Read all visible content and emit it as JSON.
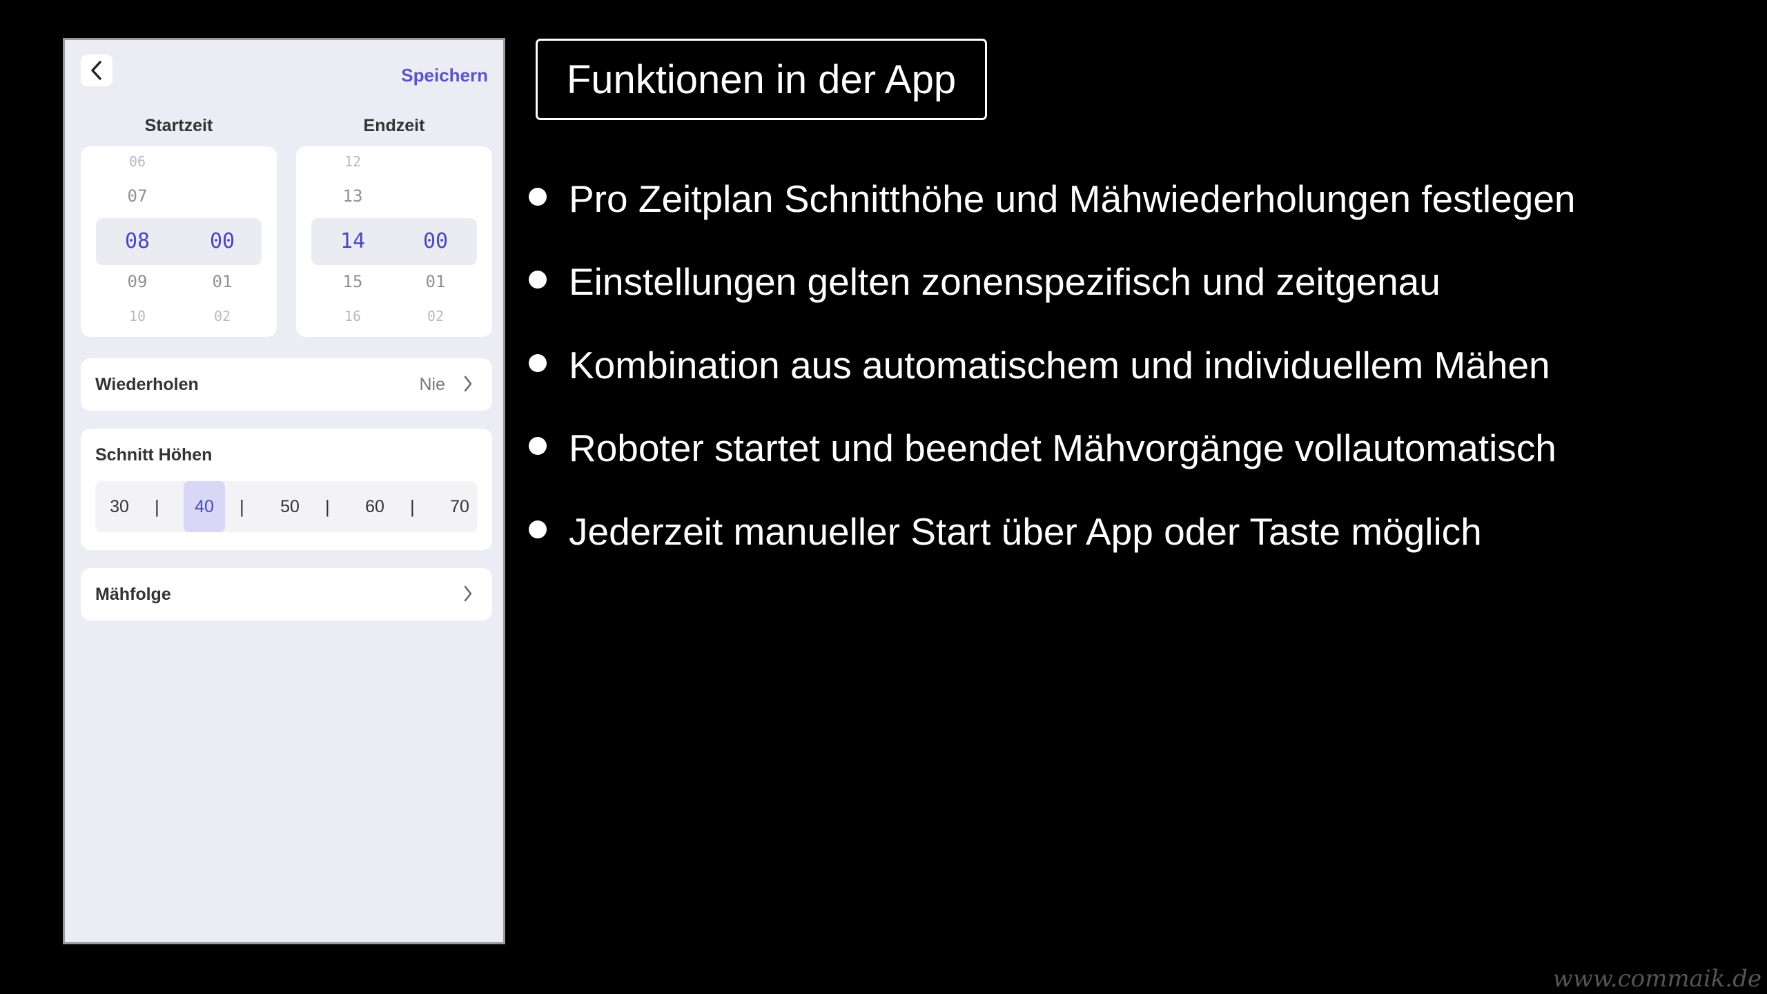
{
  "app": {
    "save_label": "Speichern",
    "start_label": "Startzeit",
    "end_label": "Endzeit",
    "start_picker": {
      "hours": [
        "06",
        "07",
        "08",
        "09",
        "10"
      ],
      "minutes": [
        "00",
        "01",
        "02"
      ],
      "selected_hour": "08",
      "selected_minute": "00"
    },
    "end_picker": {
      "hours": [
        "12",
        "13",
        "14",
        "15",
        "16"
      ],
      "minutes": [
        "00",
        "01",
        "02"
      ],
      "selected_hour": "14",
      "selected_minute": "00"
    },
    "repeat": {
      "label": "Wiederholen",
      "value": "Nie"
    },
    "cut_height": {
      "label": "Schnitt Höhen",
      "options": [
        "30",
        "40",
        "50",
        "60",
        "70"
      ],
      "selected": "40",
      "separator": "|"
    },
    "mow_order": {
      "label": "Mähfolge"
    }
  },
  "slide": {
    "title": "Funktionen in der App",
    "bullets": [
      "Pro Zeitplan Schnitthöhe und Mähwiederholungen festlegen",
      "Einstellungen gelten zonenspezifisch und zeitgenau",
      "Kombination aus automatischem und individuellem Mähen",
      "Roboter startet und beendet Mähvorgänge vollautomatisch",
      "Jederzeit manueller Start über App oder Taste möglich"
    ]
  },
  "watermark": "www.commaik.de",
  "colors": {
    "accent": "#5a55c8",
    "background": "#000000",
    "panel": "#ececf4"
  }
}
